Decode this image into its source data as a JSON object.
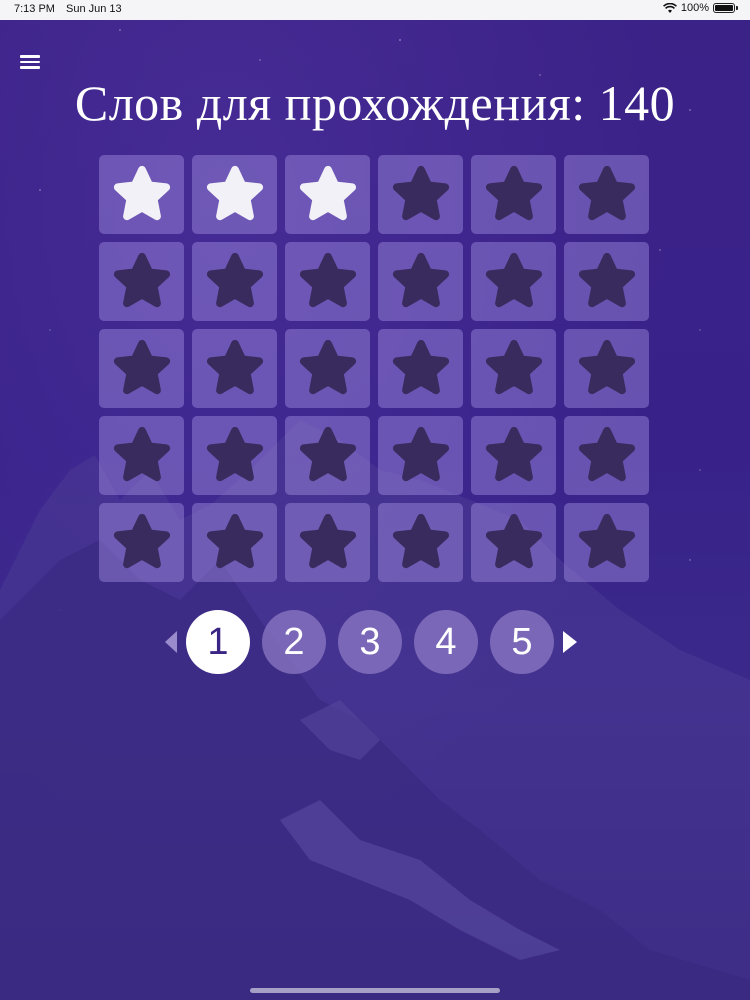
{
  "status_bar": {
    "time": "7:13 PM",
    "date": "Sun Jun 13",
    "battery": "100%",
    "wifi_icon": "wifi-icon",
    "battery_icon": "battery-icon"
  },
  "menu": {
    "icon": "hamburger-menu-icon"
  },
  "title": "Слов для прохождения: 140",
  "grid": {
    "rows": 5,
    "columns": 6,
    "levels": [
      "done",
      "done",
      "done",
      "locked",
      "locked",
      "locked",
      "locked",
      "locked",
      "locked",
      "locked",
      "locked",
      "locked",
      "locked",
      "locked",
      "locked",
      "locked",
      "locked",
      "locked",
      "locked",
      "locked",
      "locked",
      "locked",
      "locked",
      "locked",
      "locked",
      "locked",
      "locked",
      "locked",
      "locked",
      "locked"
    ],
    "icon": "star-icon"
  },
  "pagination": {
    "pages": [
      "1",
      "2",
      "3",
      "4",
      "5"
    ],
    "current": "1",
    "prev_icon": "triangle-left-icon",
    "next_icon": "triangle-right-icon"
  },
  "colors": {
    "background": "#3a2484",
    "star_done": "#f3f1f8",
    "star_locked": "#3a2b5e",
    "cell": "#7d6cc0"
  }
}
